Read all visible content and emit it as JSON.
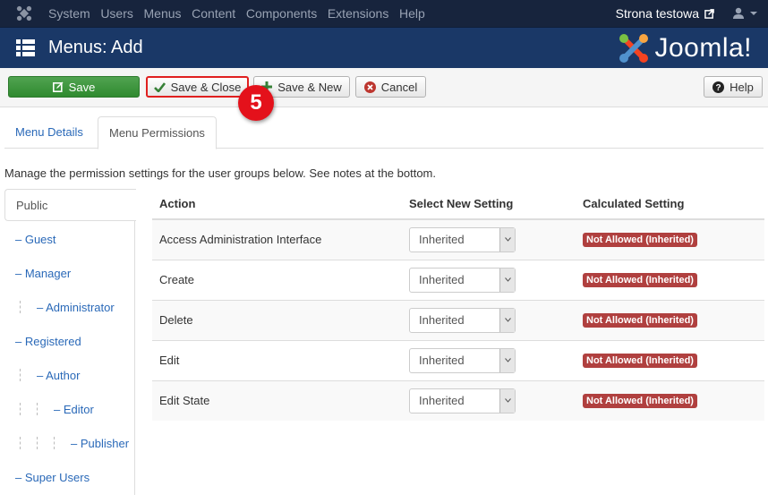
{
  "topnav": {
    "menu": [
      "System",
      "Users",
      "Menus",
      "Content",
      "Components",
      "Extensions",
      "Help"
    ],
    "site_link": "Strona testowa"
  },
  "header": {
    "title": "Menus: Add",
    "brand": "Joomla!"
  },
  "toolbar": {
    "save": "Save",
    "save_close": "Save & Close",
    "save_new": "Save & New",
    "cancel": "Cancel",
    "help": "Help"
  },
  "annotation": {
    "step": "5",
    "color": "#e4111b"
  },
  "tabs": [
    {
      "label": "Menu Details",
      "active": false
    },
    {
      "label": "Menu Permissions",
      "active": true
    }
  ],
  "description": "Manage the permission settings for the user groups below. See notes at the bottom.",
  "groups": [
    {
      "label": "Public",
      "depth": 0,
      "active": true
    },
    {
      "label": "– Guest",
      "depth": 1
    },
    {
      "label": "– Manager",
      "depth": 1
    },
    {
      "label": "– Administrator",
      "depth": 2
    },
    {
      "label": "– Registered",
      "depth": 1
    },
    {
      "label": "– Author",
      "depth": 2
    },
    {
      "label": "– Editor",
      "depth": 3
    },
    {
      "label": "– Publisher",
      "depth": 4
    },
    {
      "label": "– Super Users",
      "depth": 1
    }
  ],
  "table": {
    "headers": [
      "Action",
      "Select New Setting",
      "Calculated Setting"
    ],
    "rows": [
      {
        "action": "Access Administration Interface",
        "setting": "Inherited",
        "calculated": "Not Allowed (Inherited)"
      },
      {
        "action": "Create",
        "setting": "Inherited",
        "calculated": "Not Allowed (Inherited)"
      },
      {
        "action": "Delete",
        "setting": "Inherited",
        "calculated": "Not Allowed (Inherited)"
      },
      {
        "action": "Edit",
        "setting": "Inherited",
        "calculated": "Not Allowed (Inherited)"
      },
      {
        "action": "Edit State",
        "setting": "Inherited",
        "calculated": "Not Allowed (Inherited)"
      }
    ]
  },
  "colors": {
    "topnav_bg": "#17243d",
    "header_bg": "#1a3867",
    "save_green": "#3d9a3d",
    "link_blue": "#2a69b8",
    "not_allowed_red": "#b0403f"
  }
}
